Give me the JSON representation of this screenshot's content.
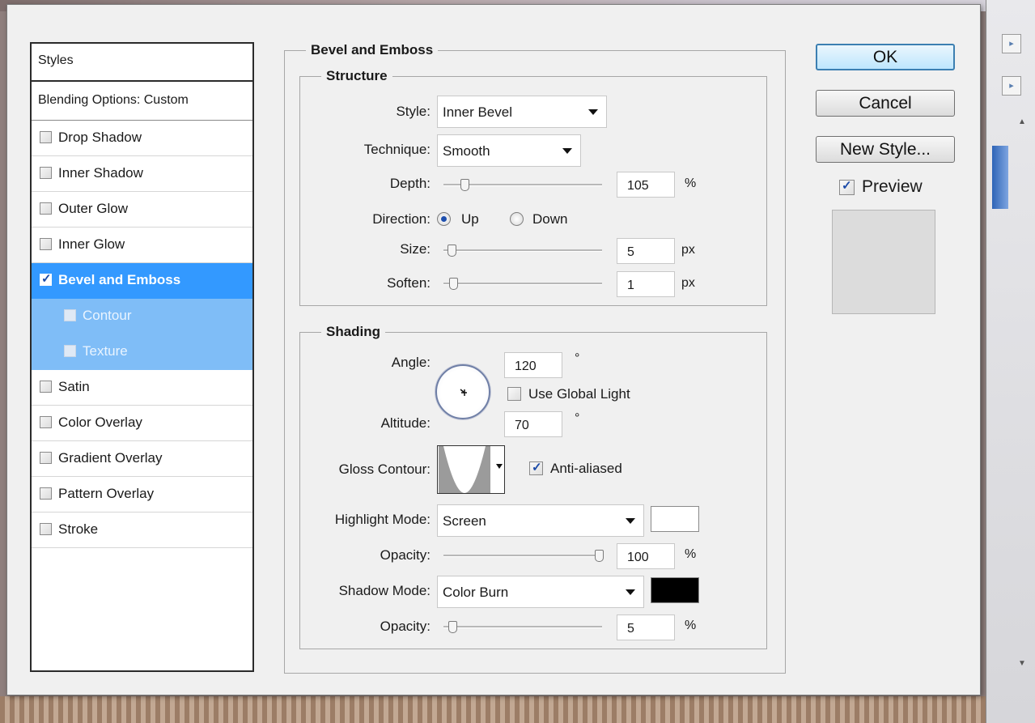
{
  "styles_panel": {
    "header": "Styles",
    "blending_options": "Blending Options: Custom",
    "effects": [
      {
        "label": "Drop Shadow",
        "checked": false
      },
      {
        "label": "Inner Shadow",
        "checked": false
      },
      {
        "label": "Outer Glow",
        "checked": false
      },
      {
        "label": "Inner Glow",
        "checked": false
      },
      {
        "label": "Bevel and Emboss",
        "checked": true
      },
      {
        "label": "Contour",
        "checked": false
      },
      {
        "label": "Texture",
        "checked": false
      },
      {
        "label": "Satin",
        "checked": false
      },
      {
        "label": "Color Overlay",
        "checked": false
      },
      {
        "label": "Gradient Overlay",
        "checked": false
      },
      {
        "label": "Pattern Overlay",
        "checked": false
      },
      {
        "label": "Stroke",
        "checked": false
      }
    ]
  },
  "bevel": {
    "title": "Bevel and Emboss",
    "structure": {
      "title": "Structure",
      "style_label": "Style:",
      "style_value": "Inner Bevel",
      "technique_label": "Technique:",
      "technique_value": "Smooth",
      "depth_label": "Depth:",
      "depth_value": "105",
      "depth_unit": "%",
      "depth_level": 0.105,
      "direction_label": "Direction:",
      "direction_up": "Up",
      "direction_down": "Down",
      "direction_selected": "Up",
      "size_label": "Size:",
      "size_value": "5",
      "size_unit": "px",
      "soften_label": "Soften:",
      "soften_value": "1",
      "soften_unit": "px"
    },
    "shading": {
      "title": "Shading",
      "angle_label": "Angle:",
      "angle_value": "120",
      "degree_symbol": "°",
      "use_global_light": "Use Global Light",
      "use_global_light_checked": false,
      "altitude_label": "Altitude:",
      "altitude_value": "70",
      "gloss_contour_label": "Gloss Contour:",
      "anti_aliased": "Anti-aliased",
      "anti_aliased_checked": true,
      "highlight_mode_label": "Highlight Mode:",
      "highlight_mode_value": "Screen",
      "highlight_color": "#ffffff",
      "highlight_opacity_label": "Opacity:",
      "highlight_opacity_value": "100",
      "shadow_mode_label": "Shadow Mode:",
      "shadow_mode_value": "Color Burn",
      "shadow_color": "#000000",
      "shadow_opacity_label": "Opacity:",
      "shadow_opacity_value": "5",
      "percent": "%"
    }
  },
  "buttons": {
    "ok": "OK",
    "cancel": "Cancel",
    "new_style": "New Style...",
    "preview": "Preview",
    "preview_checked": true
  },
  "colors": {
    "selection": "#3399ff",
    "sub_selection": "#7fbdf7"
  }
}
